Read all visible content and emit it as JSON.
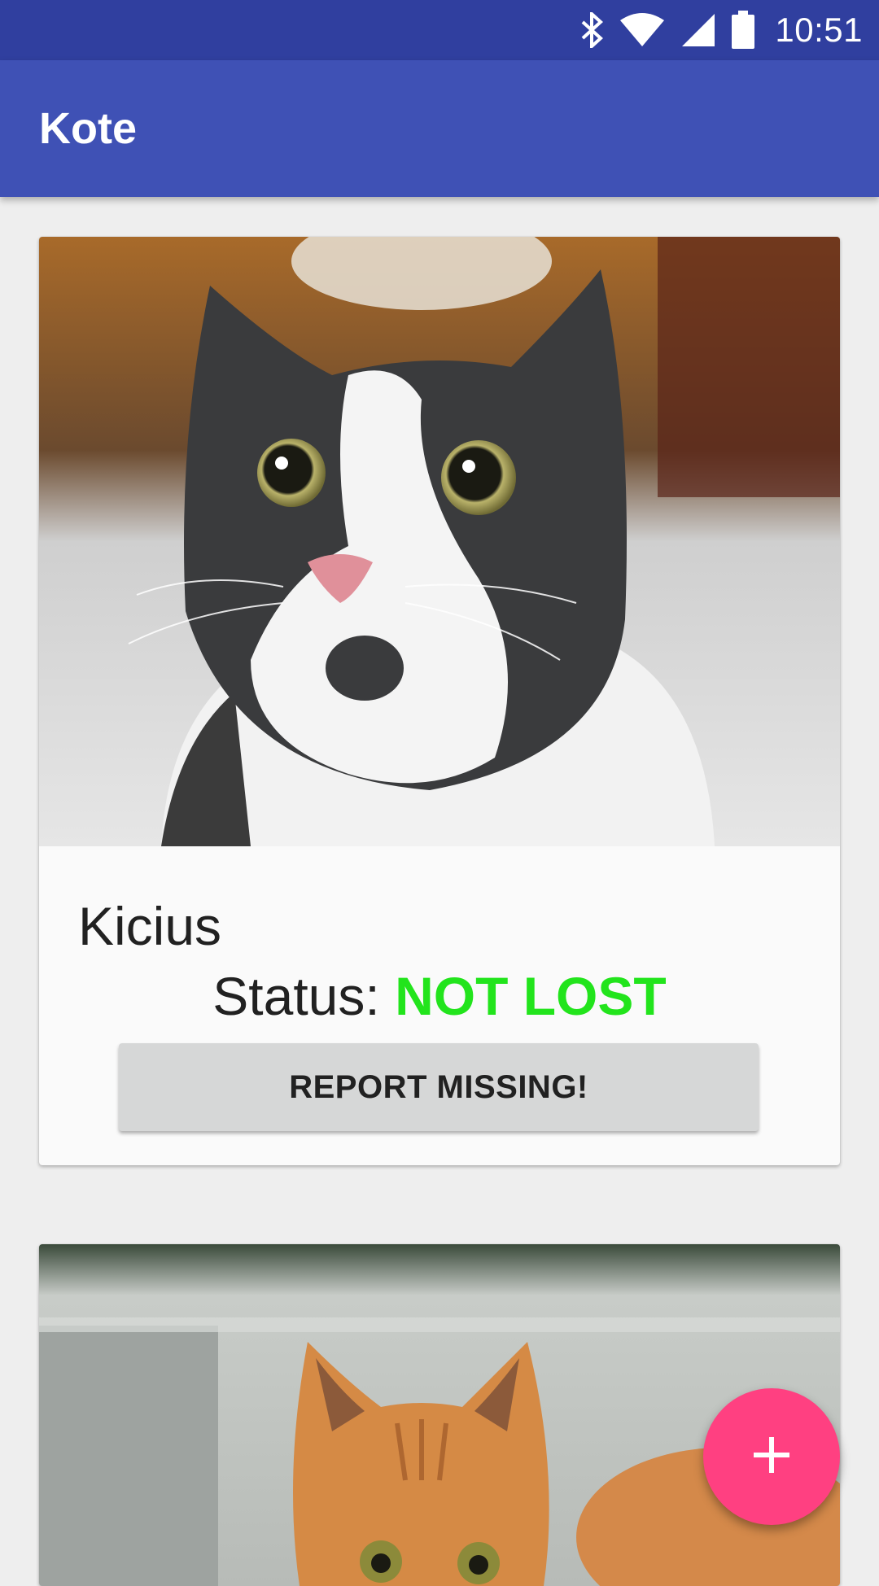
{
  "status_bar": {
    "time": "10:51",
    "icons": [
      "bluetooth-icon",
      "wifi-icon",
      "cell-signal-icon",
      "battery-icon"
    ],
    "background": "#303f9f"
  },
  "app_bar": {
    "title": "Kote",
    "background": "#3f51b5"
  },
  "cats": [
    {
      "name": "Kicius",
      "status_label": "Status: ",
      "status_value": "NOT LOST",
      "status_color": "#22e41c",
      "button_label": "REPORT MISSING!",
      "image": "gray-and-white-cat-photo"
    },
    {
      "image": "orange-tabby-kitten-photo"
    }
  ],
  "fab": {
    "icon": "plus-icon",
    "color": "#ff4081"
  }
}
